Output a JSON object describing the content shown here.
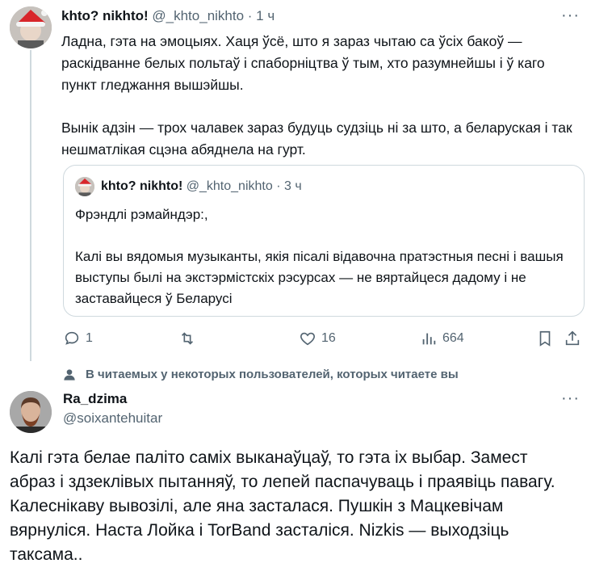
{
  "post": {
    "author_name": "khto? nikhto!",
    "author_handle": "@_khto_nikhto",
    "time": "· 1 ч",
    "more_label": "···",
    "paragraphs": [
      "Ладна, гэта на эмоцыях. Хаця ўсё, што я зараз чытаю са ўсіх бакоў — раскідванне белых польтаў і спаборніцтва ў тым, хто разумнейшы і ў каго пункт гледжання вышэйшы.",
      "Вынік адзін — трох чалавек зараз будуць судзіць ні за што, а беларуская і так нешматлікая сцэна абяднела на гурт."
    ],
    "quoted": {
      "author_name": "khto? nikhto!",
      "author_handle": "@_khto_nikhto",
      "time": "· 3 ч",
      "paragraphs": [
        "Фрэндлі рэмайндэр:,",
        "Калі вы вядомыя музыканты, якія пісалі відавочна пратэстныя песні і вашыя выступы былі на экстэрмістскіх рэсурсах — не вяртайцеся дадому і не заставайцеся ў Беларусі"
      ]
    },
    "actions": {
      "replies": "1",
      "reposts": "",
      "likes": "16",
      "views": "664"
    },
    "colors": {
      "text": "#0f1419",
      "secondary": "#536471",
      "border": "#cfd9de"
    }
  },
  "context": {
    "icon": "person-icon",
    "text": "В читаемых у некоторых пользователей, которых читаете вы"
  },
  "reply": {
    "author_name": "Ra_dzima",
    "author_handle": "@soixantehuitar",
    "more_label": "···",
    "text": "Калі гэта белае паліто саміх выканаўцаў, то гэта іх выбар. Замест абраз і здзеклівых пытанняў, то лепей паспачуваць і праявіць павагу. Калеснікаву вывозілі, але яна засталася. Пушкін з Мацкевічам вярнуліся. Наста Лойка і TorBand засталіся. Nizkis — выходзіць таксама.."
  }
}
